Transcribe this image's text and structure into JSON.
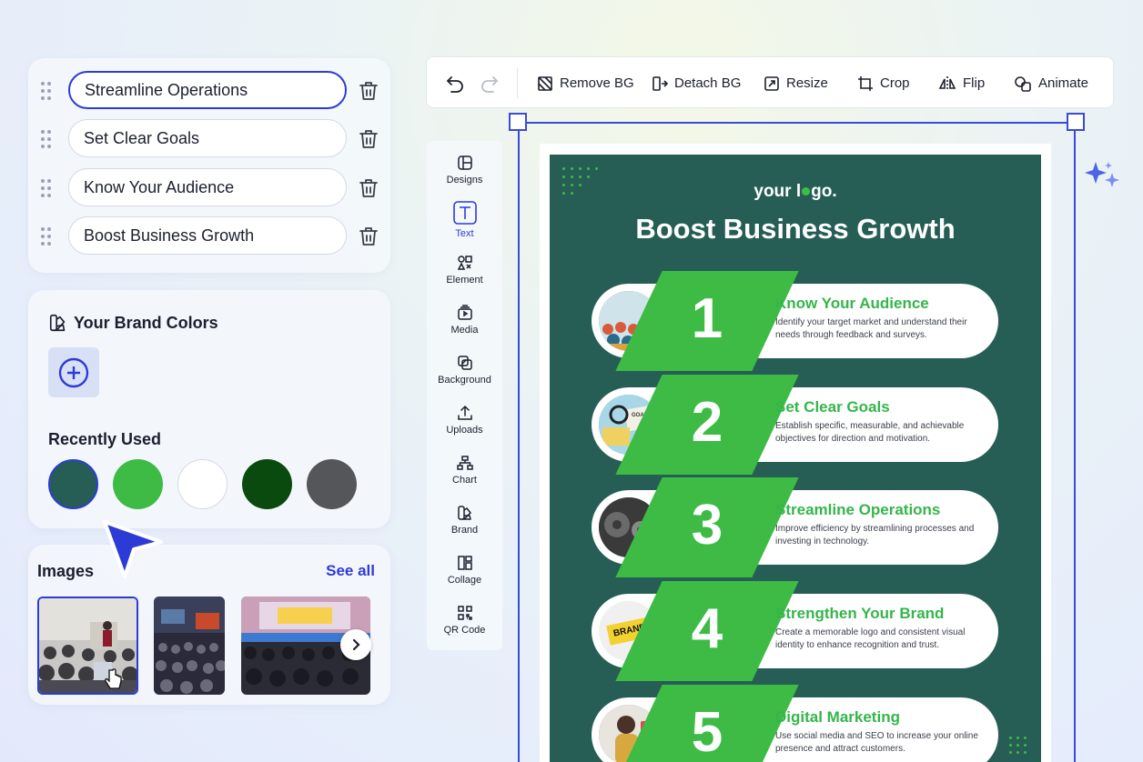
{
  "list": {
    "items": [
      {
        "label": "Streamline Operations",
        "active": true
      },
      {
        "label": "Set Clear Goals",
        "active": false
      },
      {
        "label": "Know Your Audience",
        "active": false
      },
      {
        "label": "Boost Business Growth",
        "active": false
      }
    ]
  },
  "brand": {
    "title": "Your Brand Colors",
    "recent_title": "Recently Used",
    "swatches": [
      "#265e55",
      "#3dbb45",
      "#ffffff",
      "#0b4a0f",
      "#555659"
    ],
    "selected_swatch": "#265e55"
  },
  "images": {
    "title": "Images",
    "see_all": "See all"
  },
  "toolbar": {
    "remove_bg": "Remove BG",
    "detach_bg": "Detach BG",
    "resize": "Resize",
    "crop": "Crop",
    "flip": "Flip",
    "animate": "Animate"
  },
  "sidenav": {
    "items": [
      "Designs",
      "Text",
      "Element",
      "Media",
      "Background",
      "Uploads",
      "Chart",
      "Brand",
      "Collage",
      "QR Code"
    ],
    "active": "Text"
  },
  "poster": {
    "logo_left": "your l",
    "logo_right": "go.",
    "title": "Boost Business Growth",
    "steps": [
      {
        "num": "1",
        "title": "Know Your Audience",
        "desc": "Identify your target market and understand their needs through feedback and surveys."
      },
      {
        "num": "2",
        "title": "Set Clear Goals",
        "desc": "Establish specific, measurable, and achievable objectives for direction and motivation."
      },
      {
        "num": "3",
        "title": "Streamline Operations",
        "desc": "Improve efficiency by streamlining processes and investing in technology."
      },
      {
        "num": "4",
        "title": "Strengthen Your Brand",
        "desc": "Create a memorable logo and consistent visual identity to enhance recognition and trust."
      },
      {
        "num": "5",
        "title": "Digital Marketing",
        "desc": "Use social media and SEO to increase your online presence and attract customers."
      }
    ],
    "brand_tag": "BRAND",
    "goals_tag": "GOALS"
  },
  "colors": {
    "accent": "#2d3bd6",
    "poster_bg": "#265e55",
    "poster_green": "#3dbb45"
  }
}
